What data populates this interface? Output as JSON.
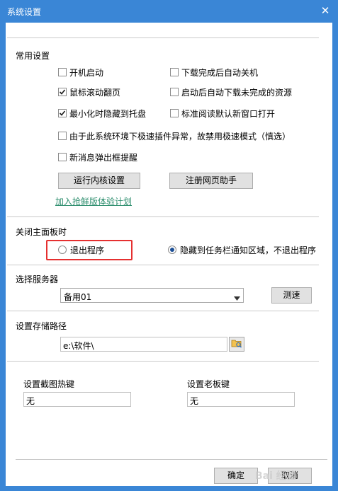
{
  "window": {
    "title": "系统设置",
    "close_glyph": "✕"
  },
  "common": {
    "heading": "常用设置",
    "options": [
      {
        "label": "开机启动",
        "checked": false
      },
      {
        "label": "下载完成后自动关机",
        "checked": false
      },
      {
        "label": "鼠标滚动翻页",
        "checked": true
      },
      {
        "label": "启动后自动下载未完成的资源",
        "checked": false
      },
      {
        "label": "最小化时隐藏到托盘",
        "checked": true
      },
      {
        "label": "标准阅读默认新窗口打开",
        "checked": false
      },
      {
        "label": "由于此系统环境下极速插件异常，故禁用极速模式（慎选）",
        "checked": false
      },
      {
        "label": "新消息弹出框提醒",
        "checked": false
      }
    ],
    "kernel_button": "运行内核设置",
    "web_helper_button": "注册网页助手",
    "beta_link": "加入抢鲜版体验计划"
  },
  "close_panel": {
    "heading": "关闭主面板时",
    "exit_label": "退出程序",
    "hide_label": "隐藏到任务栏通知区域，不退出程序",
    "selected": "hide"
  },
  "server": {
    "heading": "选择服务器",
    "selected": "备用01",
    "test_button": "测速"
  },
  "storage": {
    "heading": "设置存储路径",
    "path": "e:\\软件\\"
  },
  "hotkeys": {
    "screenshot_label": "设置截图热键",
    "screenshot_value": "无",
    "boss_label": "设置老板键",
    "boss_value": "无"
  },
  "footer": {
    "ok": "确定",
    "cancel": "取消",
    "watermark": "Bai 经验"
  },
  "colors": {
    "frame": "#3a86d6",
    "link": "#2f8f6f",
    "highlight": "#e53030"
  }
}
